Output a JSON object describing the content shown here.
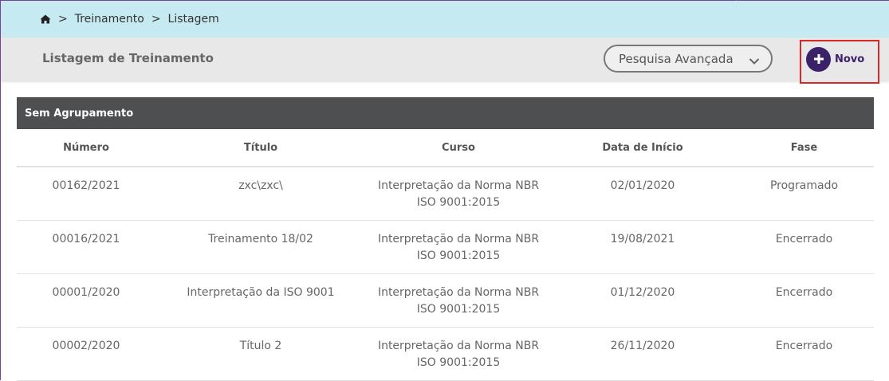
{
  "breadcrumb": {
    "icon": "home-icon",
    "items": [
      "Treinamento",
      "Listagem"
    ],
    "separator": ">"
  },
  "header": {
    "title": "Listagem de Treinamento",
    "advanced_search_label": "Pesquisa Avançada",
    "new_button_label": "Novo"
  },
  "group": {
    "label": "Sem Agrupamento"
  },
  "table": {
    "columns": [
      "Número",
      "Título",
      "Curso",
      "Data de Início",
      "Fase"
    ],
    "rows": [
      {
        "numero": "00162/2021",
        "titulo": "zxc\\zxc\\",
        "curso_line1": "Interpretação da Norma NBR",
        "curso_line2": "ISO 9001:2015",
        "data": "02/01/2020",
        "fase": "Programado"
      },
      {
        "numero": "00016/2021",
        "titulo": "Treinamento 18/02",
        "curso_line1": "Interpretação da Norma NBR",
        "curso_line2": "ISO 9001:2015",
        "data": "19/08/2021",
        "fase": "Encerrado"
      },
      {
        "numero": "00001/2020",
        "titulo": "Interpretação da ISO 9001",
        "curso_line1": "Interpretação da Norma NBR",
        "curso_line2": "ISO 9001:2015",
        "data": "01/12/2020",
        "fase": "Encerrado"
      },
      {
        "numero": "00002/2020",
        "titulo": "Título 2",
        "curso_line1": "Interpretação da Norma NBR",
        "curso_line2": "ISO 9001:2015",
        "data": "26/11/2020",
        "fase": "Encerrado"
      }
    ]
  },
  "colors": {
    "breadcrumb_bg": "#c5eaf1",
    "header_bg": "#e8e8e8",
    "group_bar_bg": "#4e4f50",
    "accent": "#3b2168",
    "highlight_border": "#d62828"
  }
}
